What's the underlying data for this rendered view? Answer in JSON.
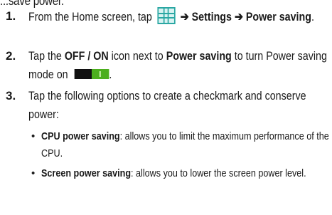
{
  "heading_fragment": "...save power.",
  "steps": [
    {
      "number": "1.",
      "text_before": "From the Home screen, tap",
      "apps_icon": "apps-grid-icon",
      "path_arrow_1": "➔",
      "path_settings": "Settings",
      "path_arrow_2": "➔",
      "path_target": "Power saving",
      "end": "."
    },
    {
      "number": "2.",
      "text_before": "Tap the",
      "emph": "OFF / ON",
      "text_mid": "icon next to",
      "emph2": "Power saving",
      "text_after": "to turn Power saving mode on",
      "toggle_icon": "on-toggle-icon",
      "end": "."
    },
    {
      "number": "3.",
      "text": "Tap the following options to create a checkmark and conserve power:"
    }
  ],
  "options": [
    {
      "bullet": "•",
      "label": "CPU power saving",
      "desc": ": allows you to limit the maximum performance of the CPU."
    },
    {
      "bullet": "•",
      "label": "Screen power saving",
      "desc": ": allows you to lower the screen power level."
    }
  ],
  "colors": {
    "icon_teal": "#2aa7a3",
    "toggle_green": "#4caf1e",
    "toggle_dark": "#111111"
  }
}
